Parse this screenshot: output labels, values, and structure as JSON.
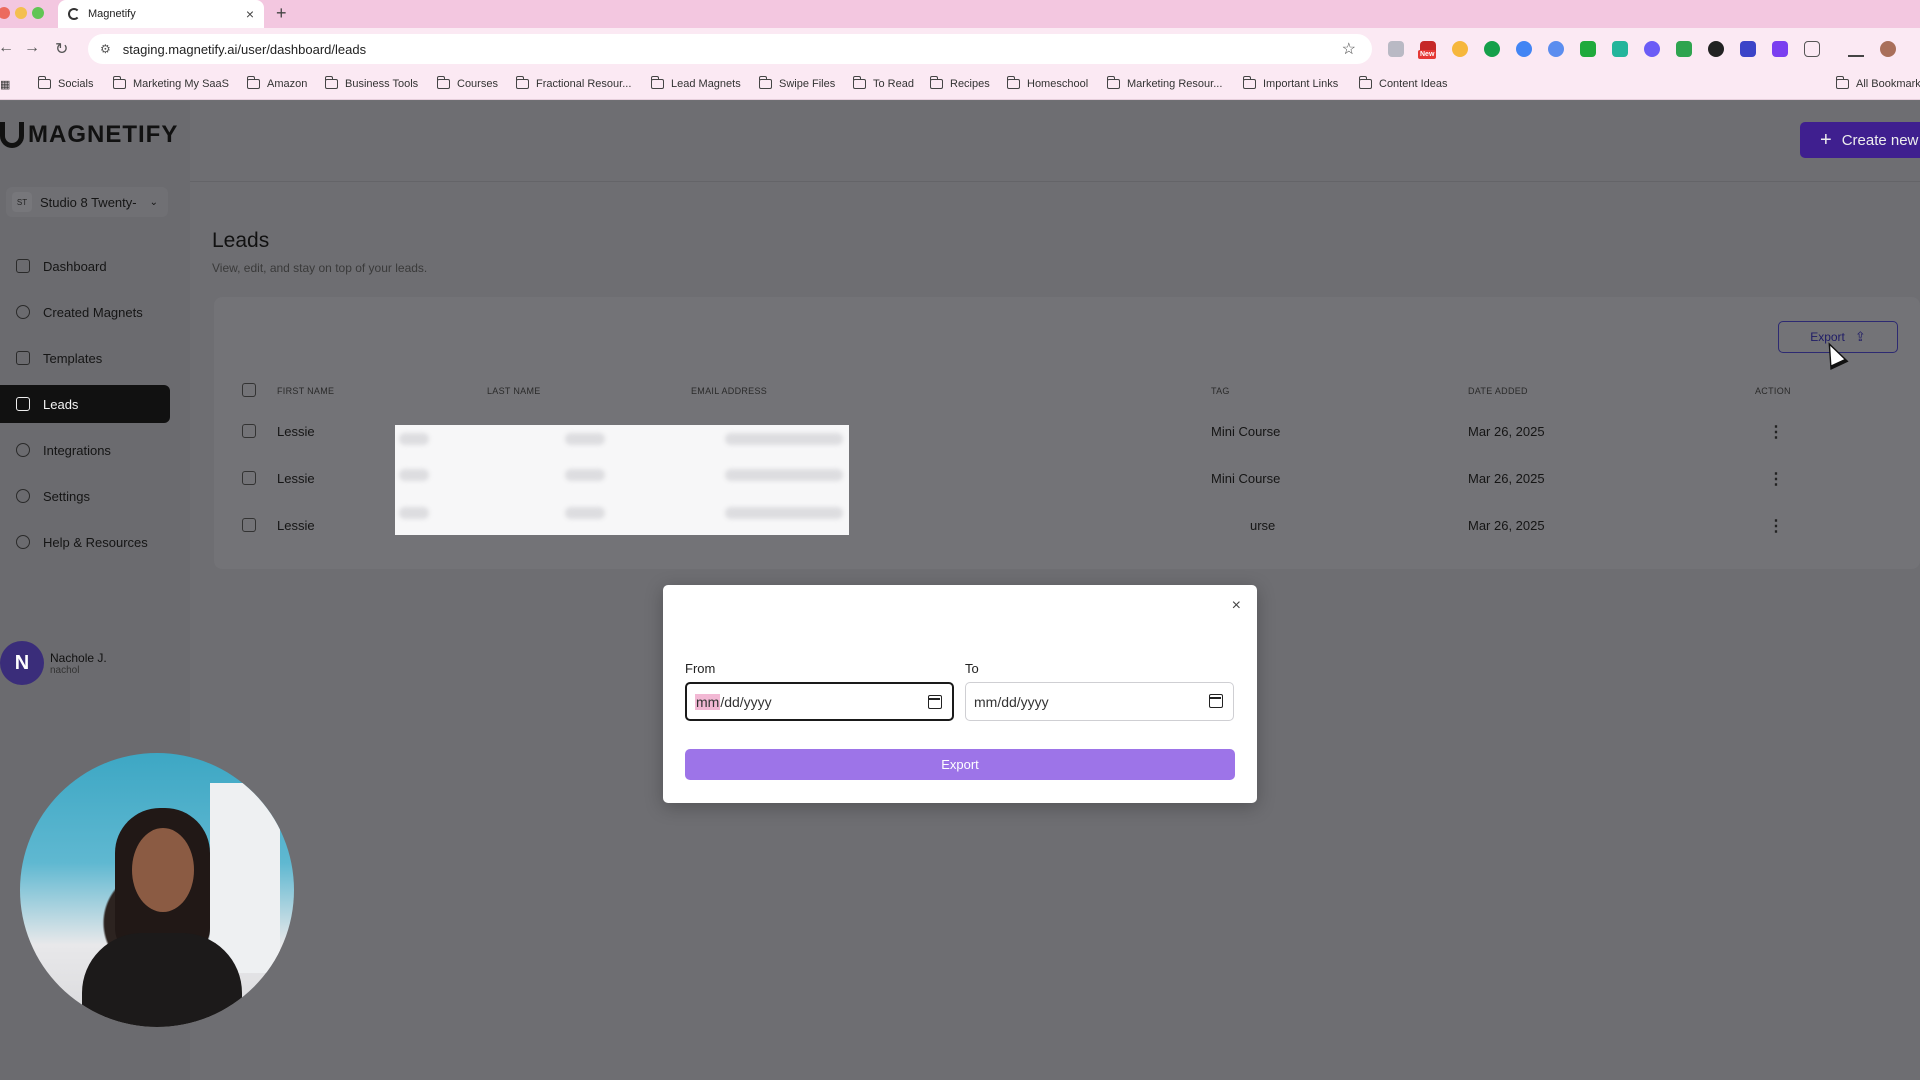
{
  "browser": {
    "tab_title": "Magnetify",
    "tab_close": "×",
    "new_tab": "+",
    "url": "staging.magnetify.ai/user/dashboard/leads",
    "ext_badge": "New",
    "bookmarks": [
      "Socials",
      "Marketing My SaaS",
      "Amazon",
      "Business Tools",
      "Courses",
      "Fractional Resour...",
      "Lead Magnets",
      "Swipe Files",
      "To Read",
      "Recipes",
      "Homeschool",
      "Marketing Resour...",
      "Important Links",
      "Content Ideas"
    ],
    "all_bookmarks": "All Bookmarks"
  },
  "app": {
    "logo": "MAGNETIFY",
    "workspace": {
      "badge": "ST",
      "name": "Studio 8 Twenty-"
    },
    "nav": [
      "Dashboard",
      "Created Magnets",
      "Templates",
      "Leads",
      "Integrations",
      "Settings",
      "Help & Resources"
    ],
    "user": {
      "initial": "N",
      "name": "Nachole J.",
      "email": "nachol"
    },
    "create_new": "Create new"
  },
  "page": {
    "title": "Leads",
    "subtitle": "View, edit, and stay on top of your leads.",
    "export_label": "Export"
  },
  "table": {
    "headers": [
      "FIRST NAME",
      "LAST NAME",
      "EMAIL ADDRESS",
      "TAG",
      "DATE ADDED",
      "ACTION"
    ],
    "rows": [
      {
        "first": "Lessie",
        "tag": "Mini Course",
        "date": "Mar 26, 2025"
      },
      {
        "first": "Lessie",
        "tag": "Mini Course",
        "date": "Mar 26, 2025"
      },
      {
        "first": "Lessie",
        "tag": "urse",
        "date": "Mar 26, 2025"
      }
    ],
    "action_glyph": "⋮"
  },
  "modal": {
    "close": "×",
    "from_label": "From",
    "to_label": "To",
    "from_mm": "mm",
    "from_rest": "/dd/yyyy",
    "to_value": "mm/dd/yyyy",
    "export_button": "Export"
  },
  "colors": {
    "accent": "#9d74e8",
    "brand_dark": "#3f1f8f",
    "overlay": "#6e6e72"
  }
}
